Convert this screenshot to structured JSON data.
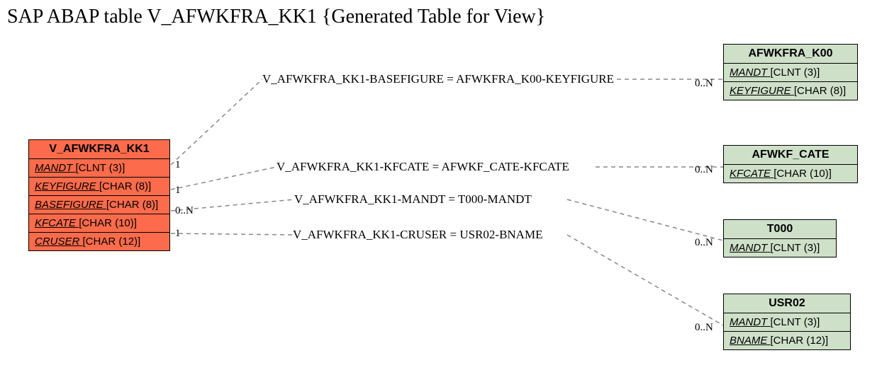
{
  "title": "SAP ABAP table V_AFWKFRA_KK1 {Generated Table for View}",
  "main_entity": {
    "name": "V_AFWKFRA_KK1",
    "attributes": [
      {
        "name": "MANDT",
        "type": "[CLNT (3)]"
      },
      {
        "name": "KEYFIGURE",
        "type": "[CHAR (8)]"
      },
      {
        "name": "BASEFIGURE",
        "type": "[CHAR (8)]"
      },
      {
        "name": "KFCATE",
        "type": "[CHAR (10)]"
      },
      {
        "name": "CRUSER",
        "type": "[CHAR (12)]"
      }
    ]
  },
  "related_entities": [
    {
      "name": "AFWKFRA_K00",
      "attributes": [
        {
          "name": "MANDT",
          "type": "[CLNT (3)]"
        },
        {
          "name": "KEYFIGURE",
          "type": "[CHAR (8)]"
        }
      ]
    },
    {
      "name": "AFWKF_CATE",
      "attributes": [
        {
          "name": "KFCATE",
          "type": "[CHAR (10)]"
        }
      ]
    },
    {
      "name": "T000",
      "attributes": [
        {
          "name": "MANDT",
          "type": "[CLNT (3)]"
        }
      ]
    },
    {
      "name": "USR02",
      "attributes": [
        {
          "name": "MANDT",
          "type": "[CLNT (3)]"
        },
        {
          "name": "BNAME",
          "type": "[CHAR (12)]"
        }
      ]
    }
  ],
  "relations": [
    {
      "label": "V_AFWKFRA_KK1-BASEFIGURE = AFWKFRA_K00-KEYFIGURE",
      "left_card": "1",
      "right_card": "0..N"
    },
    {
      "label": "V_AFWKFRA_KK1-KFCATE = AFWKF_CATE-KFCATE",
      "left_card": "1",
      "right_card": "0..N"
    },
    {
      "label": "V_AFWKFRA_KK1-MANDT = T000-MANDT",
      "left_card": "0..N",
      "right_card": "0..N"
    },
    {
      "label": "V_AFWKFRA_KK1-CRUSER = USR02-BNAME",
      "left_card": "1",
      "right_card": "0..N"
    }
  ]
}
